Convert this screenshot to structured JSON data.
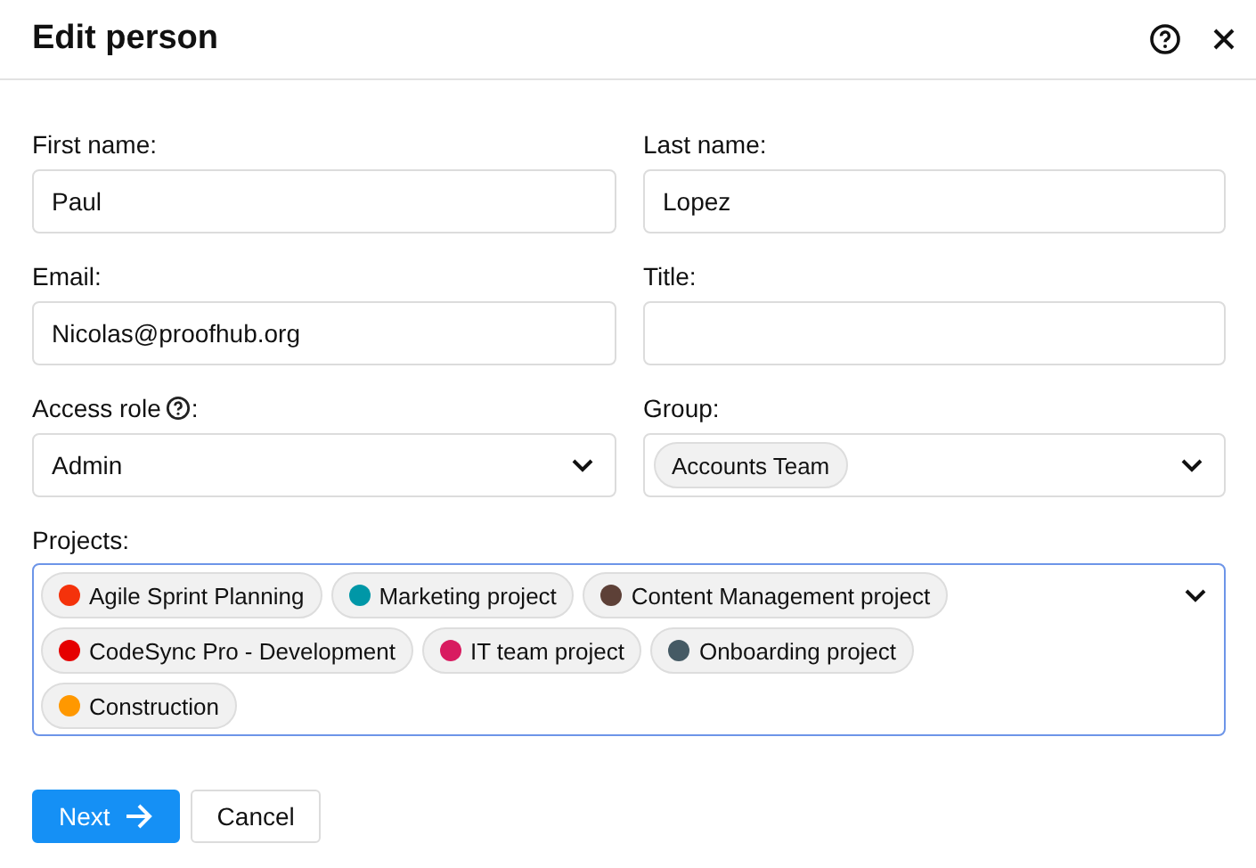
{
  "dialog": {
    "title": "Edit person"
  },
  "fields": [
    {
      "kind": "text",
      "label": "First name:",
      "value": "Paul"
    },
    {
      "kind": "text",
      "label": "Last name:",
      "value": "Lopez"
    },
    {
      "kind": "text",
      "label": "Email:",
      "value": "Nicolas@proofhub.org"
    },
    {
      "kind": "text",
      "label": "Title:"
    },
    {
      "kind": "select",
      "label": "Access role",
      "label_suffix": ":",
      "help": true,
      "value": "Admin"
    },
    {
      "kind": "chips",
      "label": "Group:",
      "chips": [
        {
          "label": "Accounts Team"
        }
      ]
    }
  ],
  "projects": {
    "label": "Projects:",
    "focused": true,
    "chips": [
      {
        "label": "Agile Sprint Planning",
        "color": "#f4320b"
      },
      {
        "label": "Marketing project",
        "color": "#0097a7"
      },
      {
        "label": "Content Management project",
        "color": "#5d4037"
      },
      {
        "label": "CodeSync Pro - Development",
        "color": "#e50000"
      },
      {
        "label": "IT team project",
        "color": "#d81b60"
      },
      {
        "label": "Onboarding project",
        "color": "#455a64"
      },
      {
        "label": "Construction",
        "color": "#ff9800"
      }
    ]
  },
  "buttons": [
    {
      "kind": "primary",
      "label": "Next"
    },
    {
      "kind": "secondary",
      "label": "Cancel"
    }
  ]
}
